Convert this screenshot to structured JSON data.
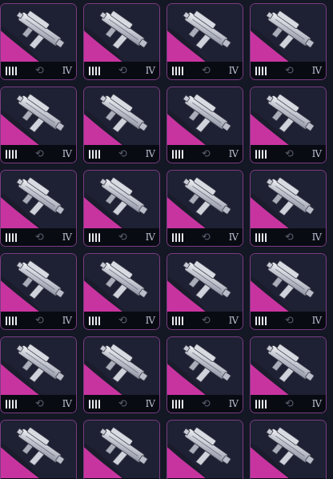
{
  "grid": {
    "columns": 4,
    "rows": 6
  },
  "colors": {
    "background": "#141724",
    "card_border": "#7a3d83",
    "rarity_accent": "#c8349f",
    "card_dark": "#1a1c2c",
    "bar": "#090b13"
  },
  "cards": [
    {
      "weapon_icon": "smg-icon",
      "ammo_icon": "ammo-icon",
      "action_icon": "swap-icon",
      "tier": "IV"
    },
    {
      "weapon_icon": "smg-icon",
      "ammo_icon": "ammo-icon",
      "action_icon": "swap-icon",
      "tier": "IV"
    },
    {
      "weapon_icon": "smg-icon",
      "ammo_icon": "ammo-icon",
      "action_icon": "swap-icon",
      "tier": "IV"
    },
    {
      "weapon_icon": "smg-icon",
      "ammo_icon": "ammo-icon",
      "action_icon": "swap-icon",
      "tier": "IV"
    },
    {
      "weapon_icon": "smg-icon",
      "ammo_icon": "ammo-icon",
      "action_icon": "swap-icon",
      "tier": "IV"
    },
    {
      "weapon_icon": "smg-icon",
      "ammo_icon": "ammo-icon",
      "action_icon": "swap-icon",
      "tier": "IV"
    },
    {
      "weapon_icon": "smg-icon",
      "ammo_icon": "ammo-icon",
      "action_icon": "swap-icon",
      "tier": "IV"
    },
    {
      "weapon_icon": "smg-icon",
      "ammo_icon": "ammo-icon",
      "action_icon": "swap-icon",
      "tier": "IV"
    },
    {
      "weapon_icon": "smg-icon",
      "ammo_icon": "ammo-icon",
      "action_icon": "swap-icon",
      "tier": "IV"
    },
    {
      "weapon_icon": "smg-icon",
      "ammo_icon": "ammo-icon",
      "action_icon": "swap-icon",
      "tier": "IV"
    },
    {
      "weapon_icon": "smg-icon",
      "ammo_icon": "ammo-icon",
      "action_icon": "swap-icon",
      "tier": "IV"
    },
    {
      "weapon_icon": "smg-icon",
      "ammo_icon": "ammo-icon",
      "action_icon": "swap-icon",
      "tier": "IV"
    },
    {
      "weapon_icon": "smg-icon",
      "ammo_icon": "ammo-icon",
      "action_icon": "swap-icon",
      "tier": "IV"
    },
    {
      "weapon_icon": "smg-icon",
      "ammo_icon": "ammo-icon",
      "action_icon": "swap-icon",
      "tier": "IV"
    },
    {
      "weapon_icon": "smg-icon",
      "ammo_icon": "ammo-icon",
      "action_icon": "swap-icon",
      "tier": "IV"
    },
    {
      "weapon_icon": "smg-icon",
      "ammo_icon": "ammo-icon",
      "action_icon": "swap-icon",
      "tier": "IV"
    },
    {
      "weapon_icon": "smg-icon",
      "ammo_icon": "ammo-icon",
      "action_icon": "swap-icon",
      "tier": "IV"
    },
    {
      "weapon_icon": "smg-icon",
      "ammo_icon": "ammo-icon",
      "action_icon": "swap-icon",
      "tier": "IV"
    },
    {
      "weapon_icon": "smg-icon",
      "ammo_icon": "ammo-icon",
      "action_icon": "swap-icon",
      "tier": "IV"
    },
    {
      "weapon_icon": "smg-icon",
      "ammo_icon": "ammo-icon",
      "action_icon": "swap-icon",
      "tier": "IV"
    },
    {
      "weapon_icon": "smg-icon",
      "ammo_icon": "ammo-icon",
      "action_icon": "swap-icon",
      "tier": ""
    },
    {
      "weapon_icon": "smg-icon",
      "ammo_icon": "ammo-icon",
      "action_icon": "swap-icon",
      "tier": ""
    },
    {
      "weapon_icon": "smg-icon",
      "ammo_icon": "ammo-icon",
      "action_icon": "swap-icon",
      "tier": ""
    },
    {
      "weapon_icon": "smg-icon",
      "ammo_icon": "ammo-icon",
      "action_icon": "swap-icon",
      "tier": ""
    }
  ]
}
